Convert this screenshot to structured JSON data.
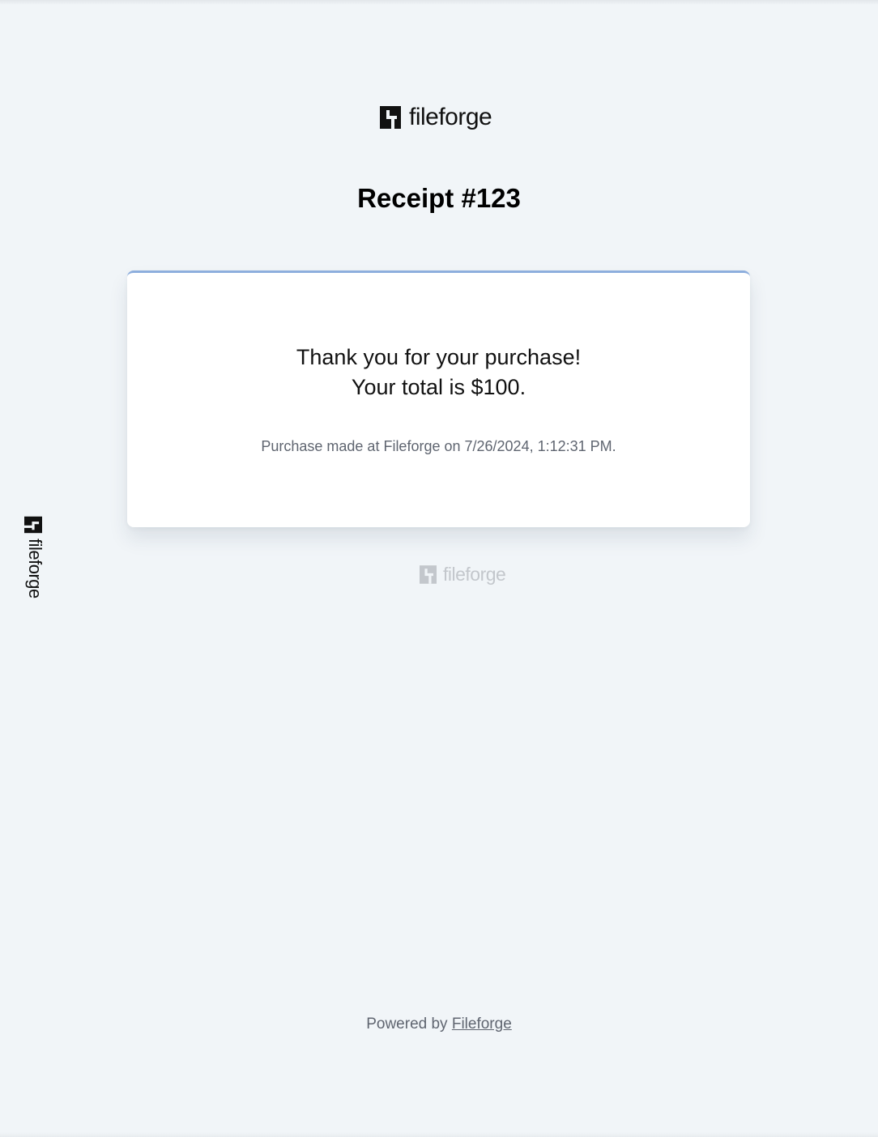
{
  "brand": {
    "logo_text": "fileforge"
  },
  "receipt": {
    "title": "Receipt #123"
  },
  "card": {
    "line1": "Thank you for your purchase!",
    "line2": "Your total is $100.",
    "meta": "Purchase made at Fileforge on 7/26/2024, 1:12:31 PM."
  },
  "footer": {
    "prefix": "Powered by ",
    "link_text": "Fileforge"
  },
  "colors": {
    "background": "#f1f5f8",
    "card_accent": "#8daedd",
    "muted_text": "#5f6570",
    "faded_logo": "#c3c7cc"
  },
  "icons": {
    "logo": "fileforge-logo-mark"
  }
}
